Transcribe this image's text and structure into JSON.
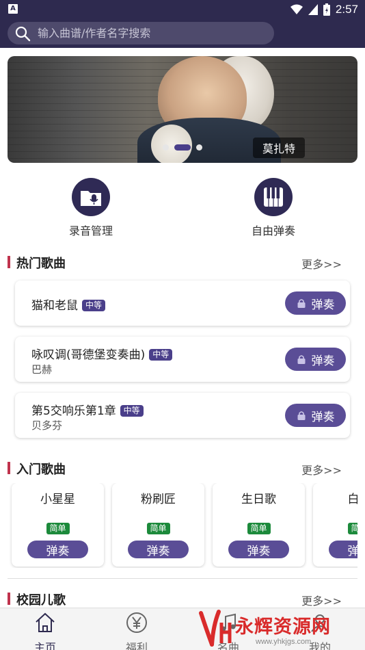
{
  "status_bar": {
    "time": "2:57",
    "app_badge": "A"
  },
  "search": {
    "placeholder": "输入曲谱/作者名字搜索"
  },
  "banner": {
    "caption": "莫扎特",
    "slide_count": 3,
    "active_slide": 1
  },
  "quick_actions": [
    {
      "label": "录音管理",
      "icon": "microphone-folder-icon"
    },
    {
      "label": "自由弹奏",
      "icon": "piano-keys-icon"
    }
  ],
  "hot_section": {
    "title": "热门歌曲",
    "more": "更多>>",
    "songs": [
      {
        "name": "猫和老鼠",
        "level": "中等",
        "artist": "",
        "play": "弹奏"
      },
      {
        "name": "咏叹调(哥德堡变奏曲)",
        "level": "中等",
        "artist": "巴赫",
        "play": "弹奏"
      },
      {
        "name": "第5交响乐第1章",
        "level": "中等",
        "artist": "贝多芬",
        "play": "弹奏"
      }
    ]
  },
  "beginner_section": {
    "title": "入门歌曲",
    "more": "更多>>",
    "songs": [
      {
        "name": "小星星",
        "level": "简单",
        "play": "弹奏"
      },
      {
        "name": "粉刷匠",
        "level": "简单",
        "play": "弹奏"
      },
      {
        "name": "生日歌",
        "level": "简单",
        "play": "弹奏"
      },
      {
        "name": "白龙",
        "level": "简单",
        "play": "弹奏"
      }
    ]
  },
  "campus_section": {
    "title": "校园儿歌",
    "more": "更多>>"
  },
  "bottom_nav": [
    {
      "label": "主页",
      "icon": "home-icon",
      "active": true
    },
    {
      "label": "福利",
      "icon": "yen-icon",
      "active": false
    },
    {
      "label": "名曲",
      "icon": "music-icon",
      "active": false
    },
    {
      "label": "我的",
      "icon": "user-icon",
      "active": false
    }
  ],
  "watermark": {
    "text": "永辉资源网",
    "url": "www.yhkjgs.com"
  },
  "colors": {
    "header": "#2e2a4f",
    "accent": "#5a4d96",
    "section_bar": "#c0334d",
    "easy_badge": "#1c8a3b"
  }
}
